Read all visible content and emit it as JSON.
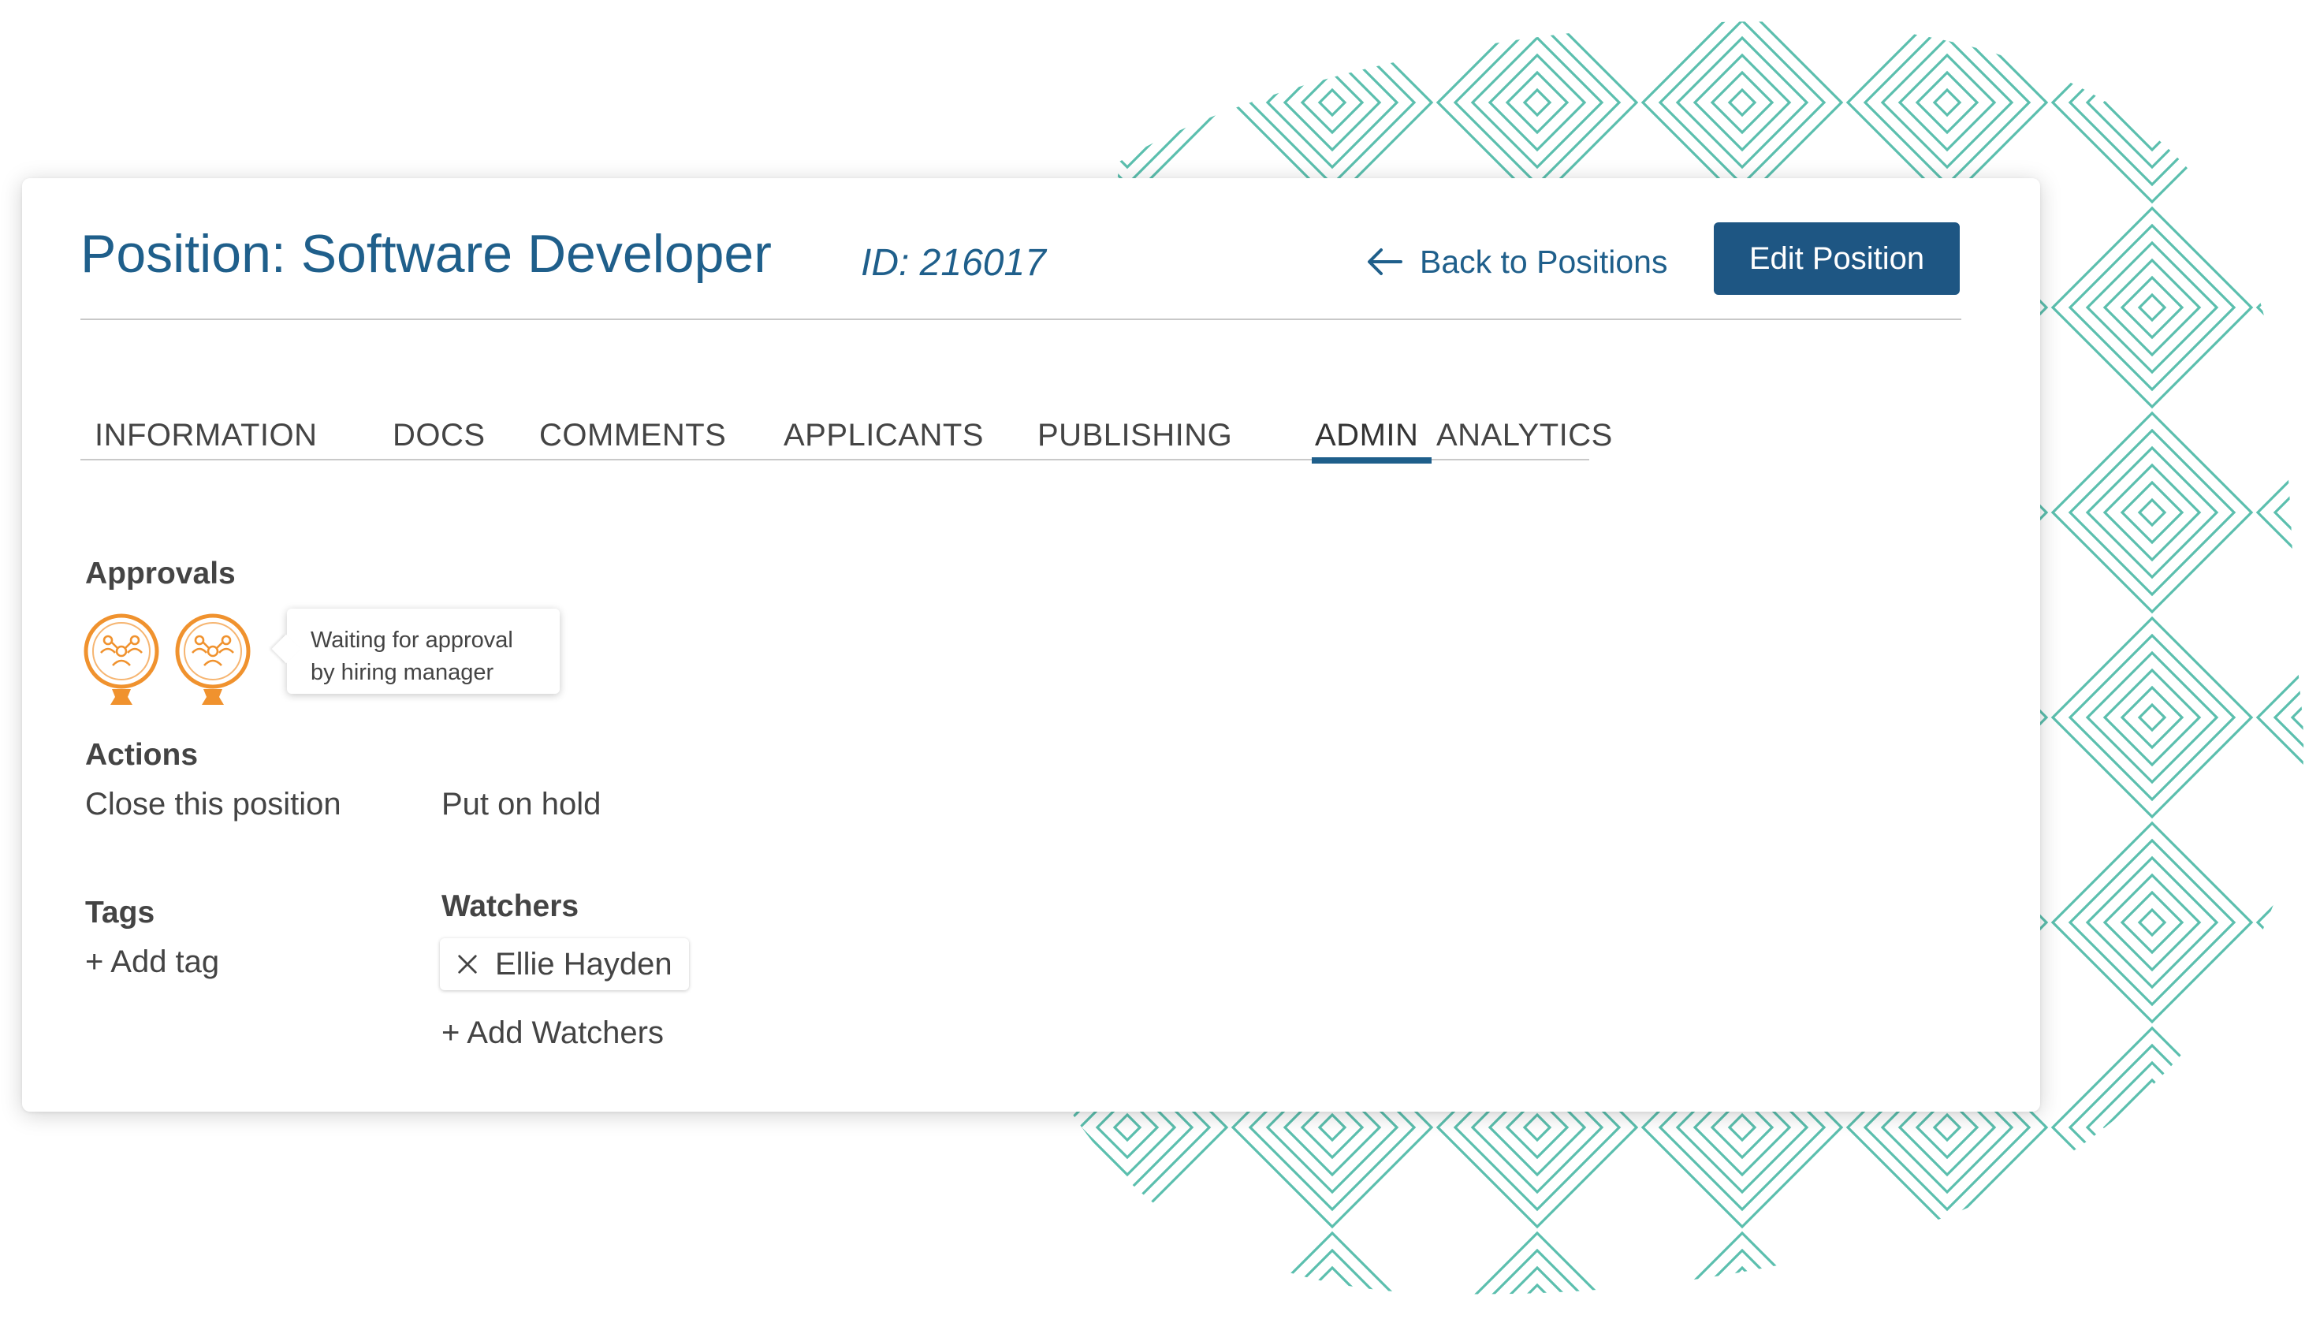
{
  "header": {
    "title": "Position: Software Developer",
    "id_text": "ID: 216017",
    "back_label": "Back to Positions",
    "edit_label": "Edit Position"
  },
  "tabs": [
    {
      "label": "INFORMATION",
      "active": false
    },
    {
      "label": "DOCS",
      "active": false
    },
    {
      "label": "COMMENTS",
      "active": false
    },
    {
      "label": "APPLICANTS",
      "active": false
    },
    {
      "label": "PUBLISHING",
      "active": false
    },
    {
      "label": "ADMIN",
      "active": true
    },
    {
      "label": "ANALYTICS",
      "active": false
    }
  ],
  "approvals": {
    "label": "Approvals",
    "approvers": [
      {
        "icon": "team-approver-icon"
      },
      {
        "icon": "team-approver-icon"
      }
    ],
    "tooltip_line1": "Waiting for approval",
    "tooltip_line2": "by hiring manager"
  },
  "actions": {
    "label": "Actions",
    "close": "Close this position",
    "hold": "Put on hold"
  },
  "tags": {
    "label": "Tags",
    "add": "+ Add tag"
  },
  "watchers": {
    "label": "Watchers",
    "items": [
      {
        "name": "Ellie Hayden"
      }
    ],
    "add": "+ Add Watchers"
  },
  "colors": {
    "brand": "#1f5f8b",
    "button": "#1e5683",
    "approval_orange": "#f0922e",
    "pattern_teal": "#5bbfae"
  }
}
